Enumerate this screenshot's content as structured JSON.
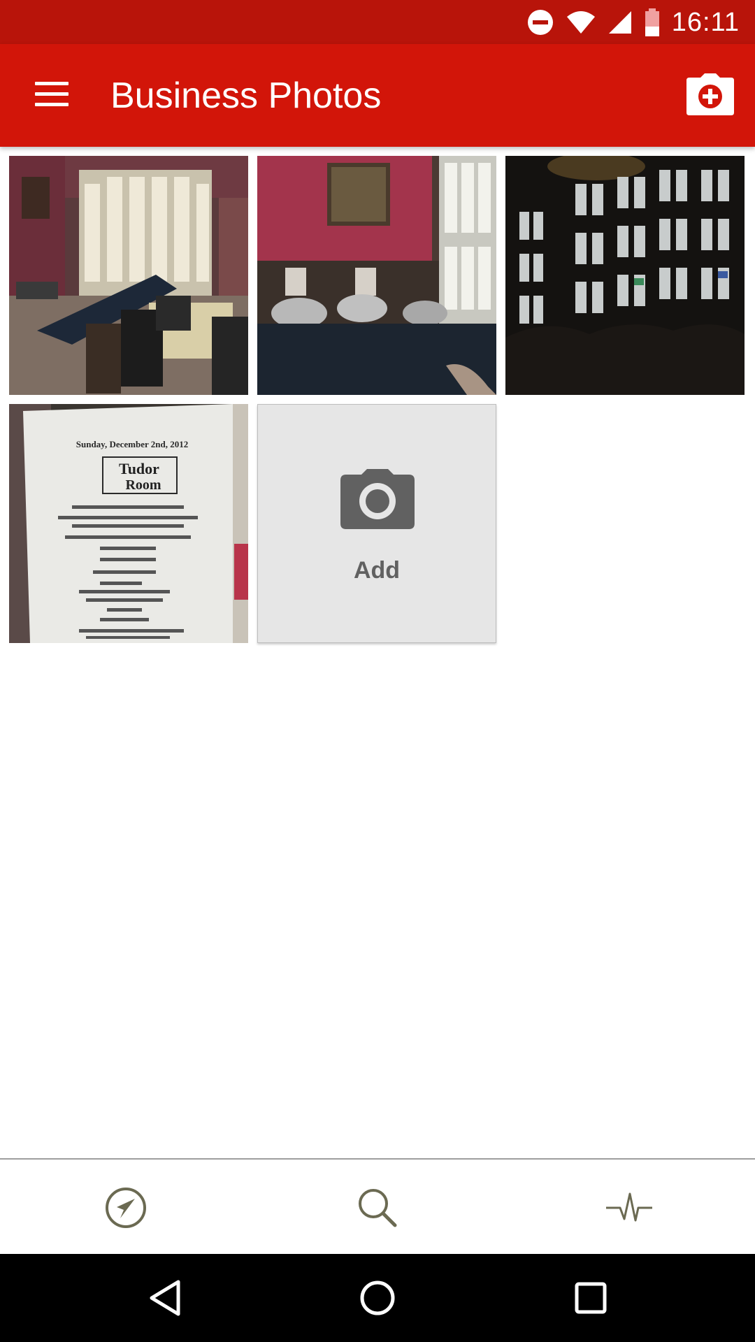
{
  "status_bar": {
    "time": "16:11",
    "icons": [
      "do-not-disturb-icon",
      "wifi-icon",
      "cell-signal-icon",
      "battery-icon"
    ]
  },
  "app_bar": {
    "title": "Business Photos",
    "menu_icon": "hamburger-menu-icon",
    "action_icon": "add-photo-camera-icon",
    "color": "#d21509"
  },
  "photos": [
    {
      "subject": "dining-room-buffet"
    },
    {
      "subject": "buffet-chafing-dishes"
    },
    {
      "subject": "stained-glass-windows"
    },
    {
      "subject": "menu-sign"
    }
  ],
  "menu_sign": {
    "date_line": "Sunday, December 2nd, 2012",
    "name_line1": "Tudor",
    "name_line2": "Room"
  },
  "add_tile": {
    "label": "Add",
    "icon": "camera-icon"
  },
  "bottom_nav": [
    {
      "name": "explore",
      "icon": "navigation-compass-icon"
    },
    {
      "name": "search",
      "icon": "search-icon"
    },
    {
      "name": "activity",
      "icon": "activity-pulse-icon"
    }
  ],
  "system_nav": [
    "back-icon",
    "home-icon",
    "recents-icon"
  ]
}
